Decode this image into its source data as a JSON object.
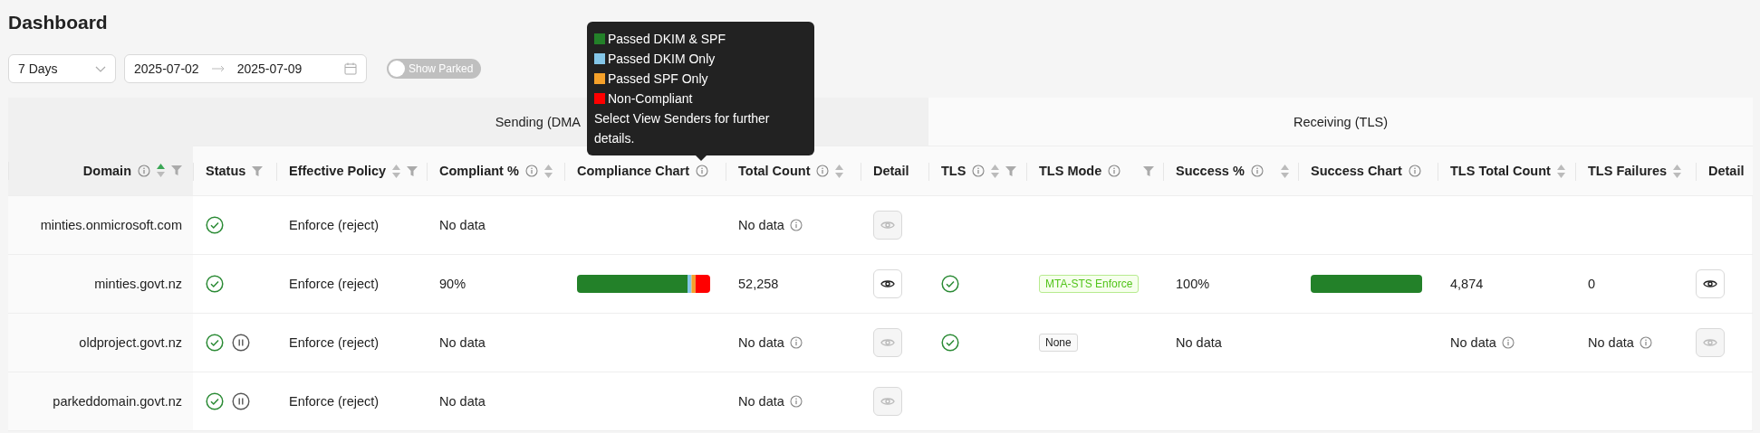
{
  "title": "Dashboard",
  "filters": {
    "range": "7 Days",
    "start_date": "2025-07-02",
    "end_date": "2025-07-09",
    "show_parked": {
      "label": "Show Parked",
      "on": false
    }
  },
  "table": {
    "groups": [
      {
        "label": "Sending (DMA"
      },
      {
        "label": "Receiving (TLS)"
      }
    ],
    "columns": [
      {
        "label": "Domain",
        "info": true,
        "sortable": true,
        "sorted": true,
        "filter": true
      },
      {
        "label": "Status",
        "filter": true
      },
      {
        "label": "Effective Policy",
        "sortable": true,
        "sorted": false,
        "filter": true
      },
      {
        "label": "Compliant %",
        "info": true,
        "sortable": true,
        "sorted": false
      },
      {
        "label": "Compliance Chart",
        "info": true
      },
      {
        "label": "Total Count",
        "info": true,
        "sortable": true,
        "sorted": false
      },
      {
        "label": "Detail"
      },
      {
        "label": "TLS",
        "info": true,
        "sortable": true,
        "sorted": false,
        "filter": true
      },
      {
        "label": "TLS Mode",
        "info": true,
        "filter": true
      },
      {
        "label": "Success %",
        "info": true,
        "sortable": true,
        "sorted": false
      },
      {
        "label": "Success Chart",
        "info": true
      },
      {
        "label": "TLS Total Count",
        "sortable": true,
        "sorted": false
      },
      {
        "label": "TLS Failures",
        "sortable": true,
        "sorted": false
      },
      {
        "label": "Detail"
      }
    ],
    "rows": [
      {
        "domain": "minties.onmicrosoft.com",
        "compliant": true,
        "parked": false,
        "policy": "Enforce (reject)",
        "compliant_pct": "No data",
        "total_count": {
          "text": "No data",
          "info": true
        },
        "detail_enabled": false
      },
      {
        "domain": "minties.govt.nz",
        "compliant": true,
        "parked": false,
        "policy": "Enforce (reject)",
        "compliant_pct": "90%",
        "total_count": {
          "text": "52,258",
          "info": false
        },
        "detail_enabled": true,
        "tls": {
          "ok": true,
          "mode": {
            "label": "MTA-STS Enforce",
            "kind": "enforce"
          },
          "success_pct": "100%",
          "success_chart": {
            "level": 1
          },
          "total_count": {
            "text": "4,874",
            "info": false
          },
          "failures": {
            "text": "0",
            "info": false
          },
          "detail_enabled": true
        }
      },
      {
        "domain": "oldproject.govt.nz",
        "compliant": true,
        "parked": true,
        "policy": "Enforce (reject)",
        "compliant_pct": "No data",
        "total_count": {
          "text": "No data",
          "info": true
        },
        "detail_enabled": false,
        "tls": {
          "ok": true,
          "mode": {
            "label": "None",
            "kind": "none"
          },
          "success_pct": "No data",
          "total_count": {
            "text": "No data",
            "info": true
          },
          "failures": {
            "text": "No data",
            "info": true
          },
          "detail_enabled": false
        }
      },
      {
        "domain": "parkeddomain.govt.nz",
        "compliant": true,
        "parked": true,
        "policy": "Enforce (reject)",
        "compliant_pct": "No data",
        "total_count": {
          "text": "No data",
          "info": true
        },
        "detail_enabled": false
      }
    ]
  },
  "tooltip": {
    "legend": [
      {
        "label": "Passed DKIM & SPF",
        "color": "#238129"
      },
      {
        "label": "Passed DKIM Only",
        "color": "#84c6e8"
      },
      {
        "label": "Passed SPF Only",
        "color": "#f5a12a"
      },
      {
        "label": "Non-Compliant",
        "color": "#ff0000"
      }
    ],
    "note": "Select View Senders for further details."
  }
}
